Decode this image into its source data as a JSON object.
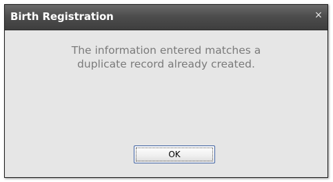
{
  "dialog": {
    "title": "Birth Registration",
    "close_glyph": "×",
    "message_line1": "The information entered matches a",
    "message_line2": "duplicate record already created.",
    "ok_label": "OK"
  },
  "colors": {
    "titlebar": "#4d4d4d",
    "body": "#e6e6e6",
    "message_text": "#7a7a7a",
    "button_border": "#3a5d9e"
  },
  "icons": {
    "close": "close-icon"
  }
}
